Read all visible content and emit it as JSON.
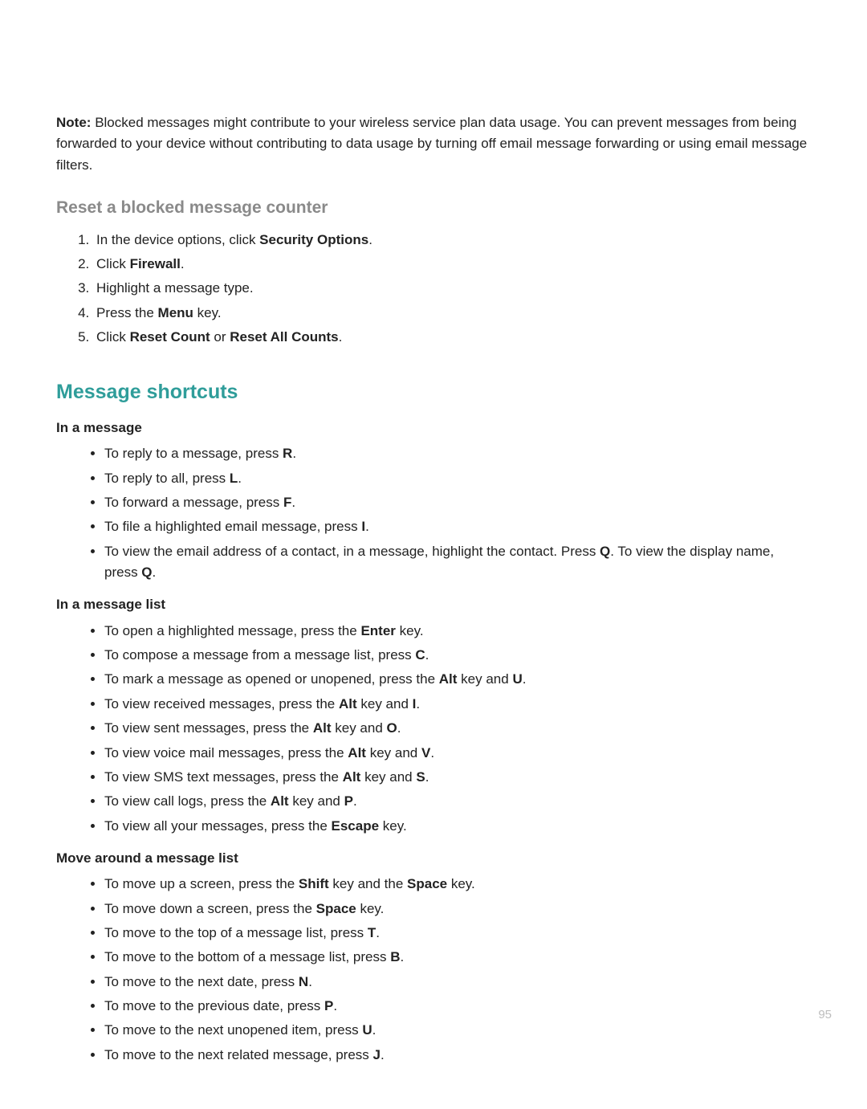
{
  "note": {
    "label": "Note:",
    "text": "Blocked messages might contribute to your wireless service plan data usage. You can prevent messages from being forwarded to your device without contributing to data usage by turning off email message forwarding or using email message filters."
  },
  "reset_section": {
    "heading": "Reset a blocked message counter",
    "steps": [
      {
        "pre": "In the device options, click ",
        "bold": "Security Options",
        "post": "."
      },
      {
        "pre": "Click ",
        "bold": "Firewall",
        "post": "."
      },
      {
        "plain": "Highlight a message type."
      },
      {
        "pre": "Press the ",
        "bold": "Menu",
        "post": " key."
      },
      {
        "pre": "Click ",
        "bold": "Reset Count",
        "mid": " or ",
        "bold2": "Reset All Counts",
        "post": "."
      }
    ]
  },
  "shortcuts": {
    "heading": "Message shortcuts",
    "groups": [
      {
        "title": "In a message",
        "items": [
          {
            "pre": "To reply to a message, press ",
            "bold": "R",
            "post": "."
          },
          {
            "pre": "To reply to all, press ",
            "bold": "L",
            "post": "."
          },
          {
            "pre": "To forward a message, press ",
            "bold": "F",
            "post": "."
          },
          {
            "pre": "To file a highlighted email message, press ",
            "bold": "I",
            "post": "."
          },
          {
            "pre": "To view the email address of a contact, in a message, highlight the contact. Press ",
            "bold": "Q",
            "mid": ". To view the display name, press ",
            "bold2": "Q",
            "post": "."
          }
        ]
      },
      {
        "title": "In a message list",
        "items": [
          {
            "pre": "To open a highlighted message, press the ",
            "bold": "Enter",
            "post": " key."
          },
          {
            "pre": "To compose a message from a message list, press ",
            "bold": "C",
            "post": "."
          },
          {
            "pre": "To mark a message as opened or unopened, press the ",
            "bold": "Alt",
            "mid": " key and ",
            "bold2": "U",
            "post": "."
          },
          {
            "pre": "To view received messages, press the ",
            "bold": "Alt",
            "mid": " key and ",
            "bold2": "I",
            "post": "."
          },
          {
            "pre": "To view sent messages, press the ",
            "bold": "Alt",
            "mid": " key and ",
            "bold2": "O",
            "post": "."
          },
          {
            "pre": "To view voice mail messages, press the ",
            "bold": "Alt",
            "mid": " key and ",
            "bold2": "V",
            "post": "."
          },
          {
            "pre": "To view SMS text messages, press the ",
            "bold": "Alt",
            "mid": " key and ",
            "bold2": "S",
            "post": "."
          },
          {
            "pre": "To view call logs, press the ",
            "bold": "Alt",
            "mid": " key and ",
            "bold2": "P",
            "post": "."
          },
          {
            "pre": "To view all your messages, press the ",
            "bold": "Escape",
            "post": " key."
          }
        ]
      },
      {
        "title": "Move around a message list",
        "items": [
          {
            "pre": "To move up a screen, press the ",
            "bold": "Shift",
            "mid": " key and the ",
            "bold2": "Space",
            "post": " key."
          },
          {
            "pre": "To move down a screen, press the ",
            "bold": "Space",
            "post": " key."
          },
          {
            "pre": "To move to the top of a message list, press ",
            "bold": "T",
            "post": "."
          },
          {
            "pre": "To move to the bottom of a message list, press ",
            "bold": "B",
            "post": "."
          },
          {
            "pre": "To move to the next date, press ",
            "bold": "N",
            "post": "."
          },
          {
            "pre": "To move to the previous date, press ",
            "bold": "P",
            "post": "."
          },
          {
            "pre": "To move to the next unopened item, press ",
            "bold": "U",
            "post": "."
          },
          {
            "pre": "To move to the next related message, press ",
            "bold": "J",
            "post": "."
          }
        ]
      }
    ]
  },
  "page_number": "95"
}
